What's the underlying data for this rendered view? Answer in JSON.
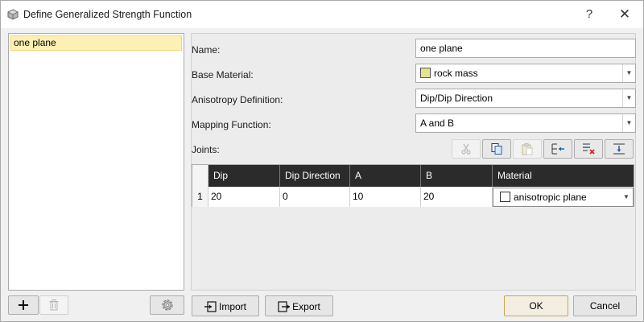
{
  "window": {
    "title": "Define Generalized Strength Function",
    "help_label": "?",
    "close_label": "✕"
  },
  "functions_list": {
    "items": [
      {
        "label": "one plane",
        "selected": true
      }
    ]
  },
  "form": {
    "name_label": "Name:",
    "name_value": "one plane",
    "base_material_label": "Base Material:",
    "base_material_value": "rock mass",
    "base_material_color": "#e1e48e",
    "anisotropy_label": "Anisotropy Definition:",
    "anisotropy_value": "Dip/Dip Direction",
    "mapping_label": "Mapping Function:",
    "mapping_value": "A and B",
    "joints_label": "Joints:"
  },
  "joints_toolbar": {
    "icons": [
      "cut-icon",
      "copy-icon",
      "paste-icon",
      "insert-row-icon",
      "delete-row-icon",
      "add-row-icon"
    ]
  },
  "joints_table": {
    "columns": [
      "Dip",
      "Dip Direction",
      "A",
      "B",
      "Material"
    ],
    "rows": [
      {
        "index": "1",
        "dip": "20",
        "dip_direction": "0",
        "a": "10",
        "b": "20",
        "material": "anisotropic plane",
        "material_color": "#ffffff"
      }
    ]
  },
  "bottom": {
    "import_label": "Import",
    "export_label": "Export",
    "ok_label": "OK",
    "cancel_label": "Cancel"
  },
  "colors": {
    "selection": "#fcf0b4",
    "header_dark": "#2b2b2b"
  }
}
